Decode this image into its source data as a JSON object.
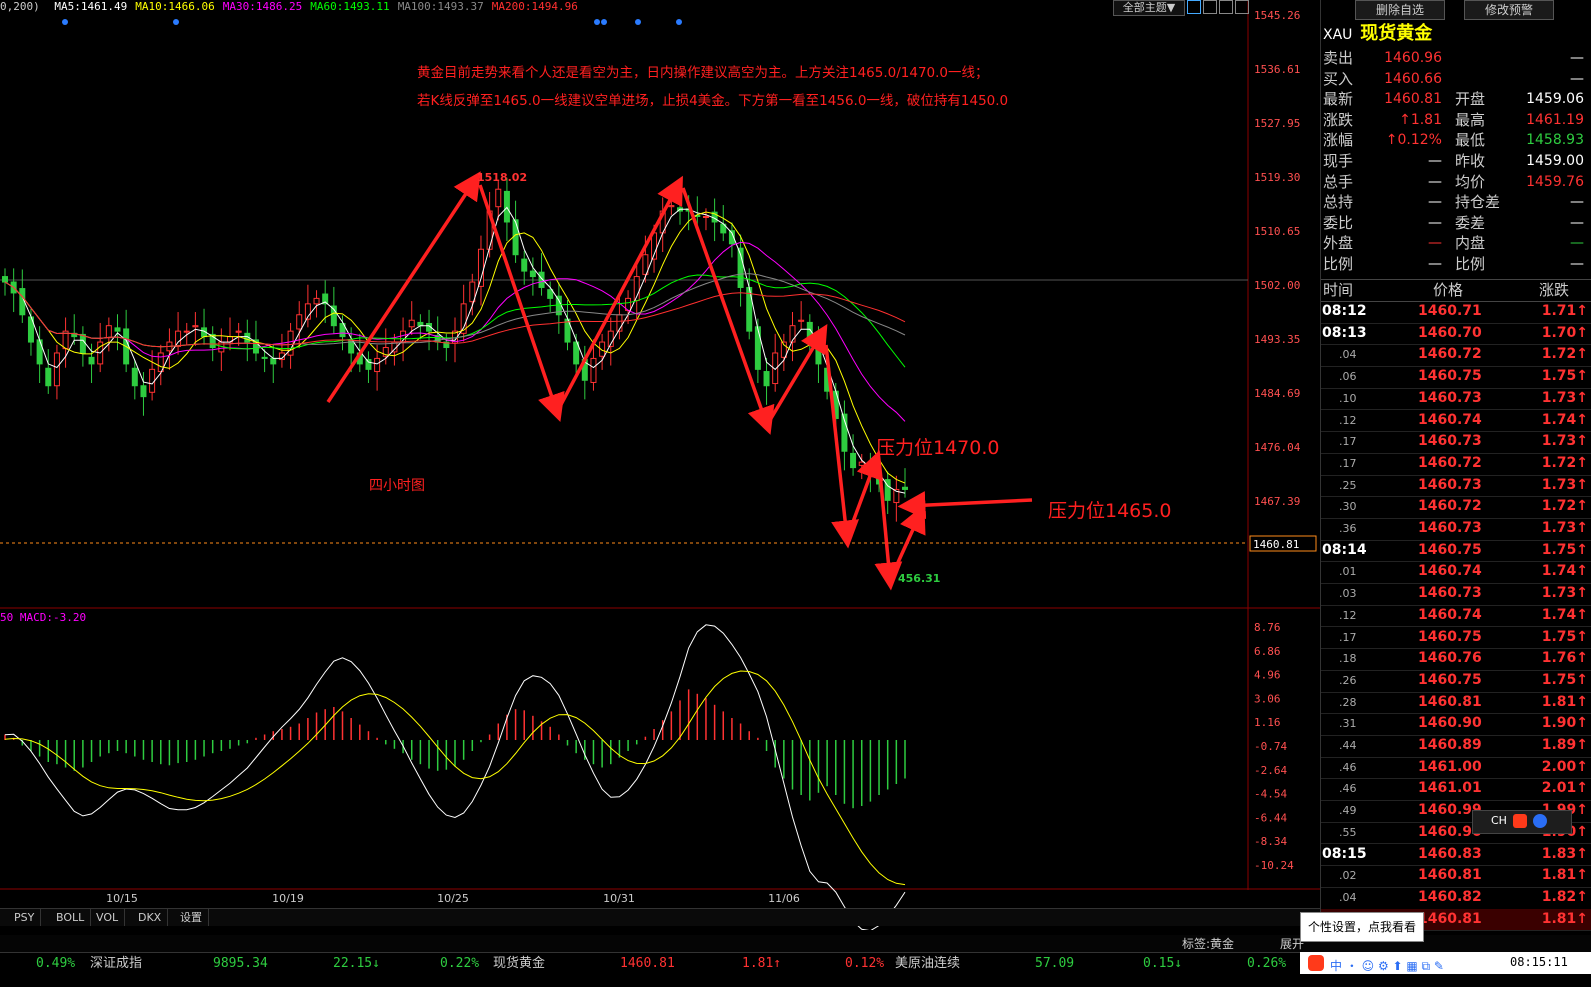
{
  "ma_line": {
    "prefix": "0,200)",
    "items": [
      {
        "text": "MA5:1461.49",
        "color": "#ffffff"
      },
      {
        "text": "MA10:1466.06",
        "color": "#ffff00"
      },
      {
        "text": "MA30:1486.25",
        "color": "#ff00ff"
      },
      {
        "text": "MA60:1493.11",
        "color": "#00ff00"
      },
      {
        "text": "MA100:1493.37",
        "color": "#888888"
      },
      {
        "text": "MA200:1494.96",
        "color": "#ff3030"
      }
    ]
  },
  "toolbar": {
    "theme_label": "全部主题▼",
    "delete_label": "删除自选",
    "alert_label": "修改预警"
  },
  "annotation": {
    "line1": "黄金目前走势来看个人还是看空为主，日内操作建议高空为主。上方关注1465.0/1470.0一线；",
    "line2": "若K线反弹至1465.0一线建议空单进场，止损4美金。下方第一看至1456.0一线，破位持有1450.0",
    "timeframe": "四小时图",
    "resist1": "压力位1470.0",
    "resist2": "压力位1465.0",
    "high_label": "1518.02",
    "low_label": "456.31"
  },
  "macd_label": "50  MACD:-3.20",
  "colors": {
    "up": "#ff3232",
    "down": "#2ecc40",
    "arrow": "#ff2020"
  },
  "chart_data": {
    "type": "candlestick",
    "y_ticks": [
      "1545.26",
      "1536.61",
      "1527.95",
      "1519.30",
      "1510.65",
      "1502.00",
      "1493.35",
      "1484.69",
      "1476.04",
      "1467.39"
    ],
    "current_price": "1460.81",
    "macd_ticks": [
      "8.76",
      "6.86",
      "4.96",
      "3.06",
      "1.16",
      "-0.74",
      "-2.64",
      "-4.54",
      "-6.44",
      "-8.34",
      "-10.24"
    ],
    "x_labels": [
      "10/15",
      "10/19",
      "10/25",
      "10/31",
      "11/06"
    ],
    "price_range": [
      1455,
      1547
    ],
    "close_path": [
      1499,
      1497,
      1493,
      1488,
      1484,
      1480,
      1486,
      1490,
      1489,
      1486,
      1484,
      1488,
      1491,
      1490,
      1484,
      1480,
      1478,
      1483,
      1486,
      1488,
      1490,
      1490,
      1491,
      1489,
      1487,
      1488,
      1489,
      1490,
      1488,
      1486,
      1485,
      1484,
      1486,
      1490,
      1493,
      1495,
      1496,
      1495,
      1491,
      1489,
      1486,
      1484,
      1483,
      1485,
      1487,
      1488,
      1490,
      1492,
      1491,
      1490,
      1488,
      1487,
      1490,
      1495,
      1499,
      1505,
      1512,
      1516,
      1510,
      1504,
      1501,
      1500,
      1498,
      1496,
      1493,
      1488,
      1484,
      1481,
      1485,
      1488,
      1490,
      1493,
      1496,
      1500,
      1504,
      1508,
      1512,
      1513,
      1512,
      1512,
      1511,
      1511,
      1510,
      1508,
      1506,
      1498,
      1490,
      1483,
      1480,
      1486,
      1488,
      1491,
      1492,
      1488,
      1484,
      1479,
      1474,
      1468,
      1465,
      1466,
      1464,
      1462,
      1459,
      1461,
      1461
    ],
    "macd_hist": [
      0.5,
      0.2,
      -0.5,
      -1,
      -1.5,
      -2,
      -2.2,
      -2.5,
      -2.8,
      -2.5,
      -2,
      -1.5,
      -1.2,
      -1,
      -1.2,
      -1.5,
      -1.8,
      -2,
      -2.2,
      -2.3,
      -2.1,
      -2,
      -1.8,
      -1.5,
      -1.2,
      -1,
      -0.8,
      -0.5,
      -0.3,
      0.2,
      0.5,
      0.8,
      1,
      1.2,
      1.5,
      2,
      2.5,
      2.8,
      3,
      2.6,
      2,
      1.4,
      0.8,
      0.2,
      -0.4,
      -0.8,
      -1.2,
      -1.8,
      -2.2,
      -2.6,
      -2.8,
      -2.7,
      -2.4,
      -1.8,
      -1,
      -0.2,
      0.5,
      1.5,
      2.3,
      2.8,
      2.7,
      2.2,
      1.7,
      1.2,
      0.5,
      -0.5,
      -1.2,
      -1.8,
      -2.2,
      -2.5,
      -2.2,
      -1.6,
      -1,
      -0.4,
      0.3,
      1,
      1.8,
      2.6,
      3.6,
      4.6,
      4.2,
      3.8,
      3.2,
      2.6,
      2,
      1.5,
      0.8,
      0.2,
      -1,
      -2.5,
      -3.5,
      -4.5,
      -5,
      -5.5,
      -4.8,
      -4.2,
      -5,
      -5.8,
      -6.2,
      -6,
      -5.6,
      -5,
      -4.5,
      -4,
      -3.5
    ]
  },
  "right_panel": {
    "symbol_code": "XAU",
    "symbol_name": "现货黄金",
    "quotes": [
      {
        "l1": "卖出",
        "v1": "1460.96",
        "c1": "red",
        "l2": "",
        "v2": "—",
        "c2": "wht"
      },
      {
        "l1": "买入",
        "v1": "1460.66",
        "c1": "red",
        "l2": "",
        "v2": "—",
        "c2": "wht"
      },
      {
        "l1": "最新",
        "v1": "1460.81",
        "c1": "red",
        "l2": "开盘",
        "v2": "1459.06",
        "c2": "wht"
      },
      {
        "l1": "涨跌",
        "v1": "↑1.81",
        "c1": "red",
        "l2": "最高",
        "v2": "1461.19",
        "c2": "red"
      },
      {
        "l1": "涨幅",
        "v1": "↑0.12%",
        "c1": "red",
        "l2": "最低",
        "v2": "1458.93",
        "c2": "grn"
      },
      {
        "l1": "现手",
        "v1": "—",
        "c1": "wht",
        "l2": "昨收",
        "v2": "1459.00",
        "c2": "wht"
      },
      {
        "l1": "总手",
        "v1": "—",
        "c1": "wht",
        "l2": "均价",
        "v2": "1459.76",
        "c2": "red"
      },
      {
        "l1": "总持",
        "v1": "—",
        "c1": "wht",
        "l2": "持仓差",
        "v2": "—",
        "c2": "wht"
      },
      {
        "l1": "委比",
        "v1": "—",
        "c1": "wht",
        "l2": "委差",
        "v2": "—",
        "c2": "wht"
      },
      {
        "l1": "外盘",
        "v1": "—",
        "c1": "red",
        "l2": "内盘",
        "v2": "—",
        "c2": "grn"
      },
      {
        "l1": "比例",
        "v1": "—",
        "c1": "wht",
        "l2": "比例",
        "v2": "—",
        "c2": "wht"
      }
    ],
    "table_headers": [
      "时间",
      "价格",
      "涨跌"
    ],
    "ticks": [
      {
        "t": "08:12",
        "big": true,
        "p": "1460.71",
        "c": "1.71↑"
      },
      {
        "t": "08:13",
        "big": true,
        "p": "1460.70",
        "c": "1.70↑"
      },
      {
        "t": ".04",
        "big": false,
        "p": "1460.72",
        "c": "1.72↑"
      },
      {
        "t": ".06",
        "big": false,
        "p": "1460.75",
        "c": "1.75↑"
      },
      {
        "t": ".10",
        "big": false,
        "p": "1460.73",
        "c": "1.73↑"
      },
      {
        "t": ".12",
        "big": false,
        "p": "1460.74",
        "c": "1.74↑"
      },
      {
        "t": ".17",
        "big": false,
        "p": "1460.73",
        "c": "1.73↑"
      },
      {
        "t": ".17",
        "big": false,
        "p": "1460.72",
        "c": "1.72↑"
      },
      {
        "t": ".25",
        "big": false,
        "p": "1460.73",
        "c": "1.73↑"
      },
      {
        "t": ".30",
        "big": false,
        "p": "1460.72",
        "c": "1.72↑"
      },
      {
        "t": ".36",
        "big": false,
        "p": "1460.73",
        "c": "1.73↑"
      },
      {
        "t": "08:14",
        "big": true,
        "p": "1460.75",
        "c": "1.75↑"
      },
      {
        "t": ".01",
        "big": false,
        "p": "1460.74",
        "c": "1.74↑"
      },
      {
        "t": ".03",
        "big": false,
        "p": "1460.73",
        "c": "1.73↑"
      },
      {
        "t": ".12",
        "big": false,
        "p": "1460.74",
        "c": "1.74↑"
      },
      {
        "t": ".17",
        "big": false,
        "p": "1460.75",
        "c": "1.75↑"
      },
      {
        "t": ".18",
        "big": false,
        "p": "1460.76",
        "c": "1.76↑"
      },
      {
        "t": ".26",
        "big": false,
        "p": "1460.75",
        "c": "1.75↑"
      },
      {
        "t": ".28",
        "big": false,
        "p": "1460.81",
        "c": "1.81↑"
      },
      {
        "t": ".31",
        "big": false,
        "p": "1460.90",
        "c": "1.90↑"
      },
      {
        "t": ".44",
        "big": false,
        "p": "1460.89",
        "c": "1.89↑"
      },
      {
        "t": ".46",
        "big": false,
        "p": "1461.00",
        "c": "2.00↑"
      },
      {
        "t": ".46",
        "big": false,
        "p": "1461.01",
        "c": "2.01↑"
      },
      {
        "t": ".49",
        "big": false,
        "p": "1460.99",
        "c": "1.99↑"
      },
      {
        "t": ".55",
        "big": false,
        "p": "1460.90",
        "c": "1.90↑"
      },
      {
        "t": "08:15",
        "big": true,
        "p": "1460.83",
        "c": "1.83↑"
      },
      {
        "t": ".02",
        "big": false,
        "p": "1460.81",
        "c": "1.81↑"
      },
      {
        "t": ".04",
        "big": false,
        "p": "1460.82",
        "c": "1.82↑"
      },
      {
        "t": "",
        "big": false,
        "p": "1460.81",
        "c": "1.81↑"
      }
    ]
  },
  "tabs": [
    "PSY",
    "BOLL",
    "VOL",
    "DKX",
    "设置"
  ],
  "status": {
    "tag": "标签:黄金",
    "expand": "展开"
  },
  "tooltip": "个性设置，点我看看",
  "ticker": [
    {
      "text": "0.49%",
      "color": "#2ecc40"
    },
    {
      "text": "深证成指",
      "color": "#ccc"
    },
    {
      "text": "9895.34",
      "color": "#2ecc40"
    },
    {
      "text": "22.15↓",
      "color": "#2ecc40"
    },
    {
      "text": "0.22%",
      "color": "#2ecc40"
    },
    {
      "text": "现货黄金",
      "color": "#ccc"
    },
    {
      "text": "1460.81",
      "color": "#ff3232"
    },
    {
      "text": "1.81↑",
      "color": "#ff3232"
    },
    {
      "text": "0.12%",
      "color": "#ff3232"
    },
    {
      "text": "美原油连续",
      "color": "#ccc"
    },
    {
      "text": "57.09",
      "color": "#2ecc40"
    },
    {
      "text": "0.15↓",
      "color": "#2ecc40"
    },
    {
      "text": "0.26%",
      "color": "#2ecc40"
    }
  ],
  "clock": "08:15:11",
  "ime_label": "CH"
}
